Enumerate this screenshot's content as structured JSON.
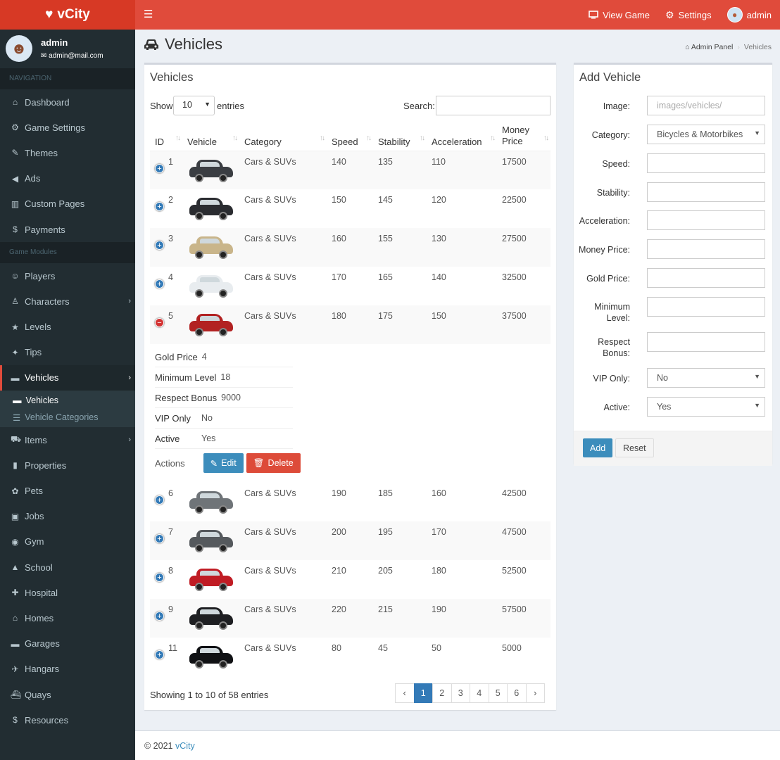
{
  "brand": "vCity",
  "topnav": {
    "view_game": "View Game",
    "settings": "Settings",
    "user": "admin"
  },
  "user": {
    "name": "admin",
    "email": "admin@mail.com"
  },
  "sidebar": {
    "nav_header": "NAVIGATION",
    "main": [
      {
        "label": "Dashboard",
        "icon": "dashboard-icon"
      },
      {
        "label": "Game Settings",
        "icon": "gears-icon"
      },
      {
        "label": "Themes",
        "icon": "brush-icon"
      },
      {
        "label": "Ads",
        "icon": "bullhorn-icon"
      },
      {
        "label": "Custom Pages",
        "icon": "columns-icon"
      },
      {
        "label": "Payments",
        "icon": "dollar-icon"
      }
    ],
    "modules_header": "Game Modules",
    "modules": [
      {
        "label": "Players",
        "icon": "users-icon"
      },
      {
        "label": "Characters",
        "icon": "child-icon"
      },
      {
        "label": "Levels",
        "icon": "star-icon"
      },
      {
        "label": "Tips",
        "icon": "lightbulb-icon"
      },
      {
        "label": "Vehicles",
        "icon": "car-icon"
      },
      {
        "label": "Items",
        "icon": "cart-icon"
      },
      {
        "label": "Properties",
        "icon": "building-icon"
      },
      {
        "label": "Pets",
        "icon": "paw-icon"
      },
      {
        "label": "Jobs",
        "icon": "briefcase-icon"
      },
      {
        "label": "Gym",
        "icon": "futbol-icon"
      },
      {
        "label": "School",
        "icon": "graduation-cap-icon"
      },
      {
        "label": "Hospital",
        "icon": "hospital-icon"
      },
      {
        "label": "Homes",
        "icon": "home-icon"
      },
      {
        "label": "Garages",
        "icon": "car-icon"
      },
      {
        "label": "Hangars",
        "icon": "plane-icon"
      },
      {
        "label": "Quays",
        "icon": "ship-icon"
      },
      {
        "label": "Resources",
        "icon": "dollar-icon"
      }
    ],
    "sub": [
      {
        "label": "Vehicles",
        "icon": "car-icon"
      },
      {
        "label": "Vehicle Categories",
        "icon": "list-icon"
      }
    ]
  },
  "page": {
    "title": "Vehicles",
    "breadcrumb_home": "Admin Panel",
    "breadcrumb_current": "Vehicles"
  },
  "table_box": {
    "title": "Vehicles",
    "show": "Show",
    "entries_value": "10",
    "entries": "entries",
    "search": "Search:",
    "columns": [
      "ID",
      "Vehicle",
      "Category",
      "Speed",
      "Stability",
      "Acceleration",
      "Money Price"
    ],
    "rows": [
      {
        "id": "1",
        "category": "Cars & SUVs",
        "speed": "140",
        "stability": "135",
        "acceleration": "110",
        "money": "17500",
        "color": "#3a3d42"
      },
      {
        "id": "2",
        "category": "Cars & SUVs",
        "speed": "150",
        "stability": "145",
        "acceleration": "120",
        "money": "22500",
        "color": "#2a2c30"
      },
      {
        "id": "3",
        "category": "Cars & SUVs",
        "speed": "160",
        "stability": "155",
        "acceleration": "130",
        "money": "27500",
        "color": "#c9b58a"
      },
      {
        "id": "4",
        "category": "Cars & SUVs",
        "speed": "170",
        "stability": "165",
        "acceleration": "140",
        "money": "32500",
        "color": "#e8ecef"
      },
      {
        "id": "5",
        "category": "Cars & SUVs",
        "speed": "180",
        "stability": "175",
        "acceleration": "150",
        "money": "37500",
        "color": "#b22222"
      },
      {
        "id": "6",
        "category": "Cars & SUVs",
        "speed": "190",
        "stability": "185",
        "acceleration": "160",
        "money": "42500",
        "color": "#6f7478"
      },
      {
        "id": "7",
        "category": "Cars & SUVs",
        "speed": "200",
        "stability": "195",
        "acceleration": "170",
        "money": "47500",
        "color": "#55595d"
      },
      {
        "id": "8",
        "category": "Cars & SUVs",
        "speed": "210",
        "stability": "205",
        "acceleration": "180",
        "money": "52500",
        "color": "#c01c24"
      },
      {
        "id": "9",
        "category": "Cars & SUVs",
        "speed": "220",
        "stability": "215",
        "acceleration": "190",
        "money": "57500",
        "color": "#1e1f22"
      },
      {
        "id": "11",
        "category": "Cars & SUVs",
        "speed": "80",
        "stability": "45",
        "acceleration": "50",
        "money": "5000",
        "color": "#101114"
      }
    ],
    "details": [
      {
        "k": "Gold Price",
        "v": "4"
      },
      {
        "k": "Minimum Level",
        "v": "18"
      },
      {
        "k": "Respect Bonus",
        "v": "9000"
      },
      {
        "k": "VIP Only",
        "v": "No"
      },
      {
        "k": "Active",
        "v": "Yes"
      }
    ],
    "actions_label": "Actions",
    "edit": "Edit",
    "delete": "Delete",
    "showing": "Showing 1 to 10 of 58 entries",
    "pages": [
      "1",
      "2",
      "3",
      "4",
      "5",
      "6"
    ]
  },
  "add_box": {
    "title": "Add Vehicle",
    "image_label": "Image:",
    "image_placeholder": "images/vehicles/",
    "category_label": "Category:",
    "category_value": "Bicycles & Motorbikes",
    "speed_label": "Speed:",
    "stability_label": "Stability:",
    "acceleration_label": "Acceleration:",
    "money_label": "Money Price:",
    "gold_label": "Gold Price:",
    "min_level_label": "Minimum Level:",
    "respect_label": "Respect Bonus:",
    "vip_label": "VIP Only:",
    "vip_value": "No",
    "active_label": "Active:",
    "active_value": "Yes",
    "add": "Add",
    "reset": "Reset"
  },
  "footer": {
    "copy": "© 2021",
    "link": "vCity"
  }
}
